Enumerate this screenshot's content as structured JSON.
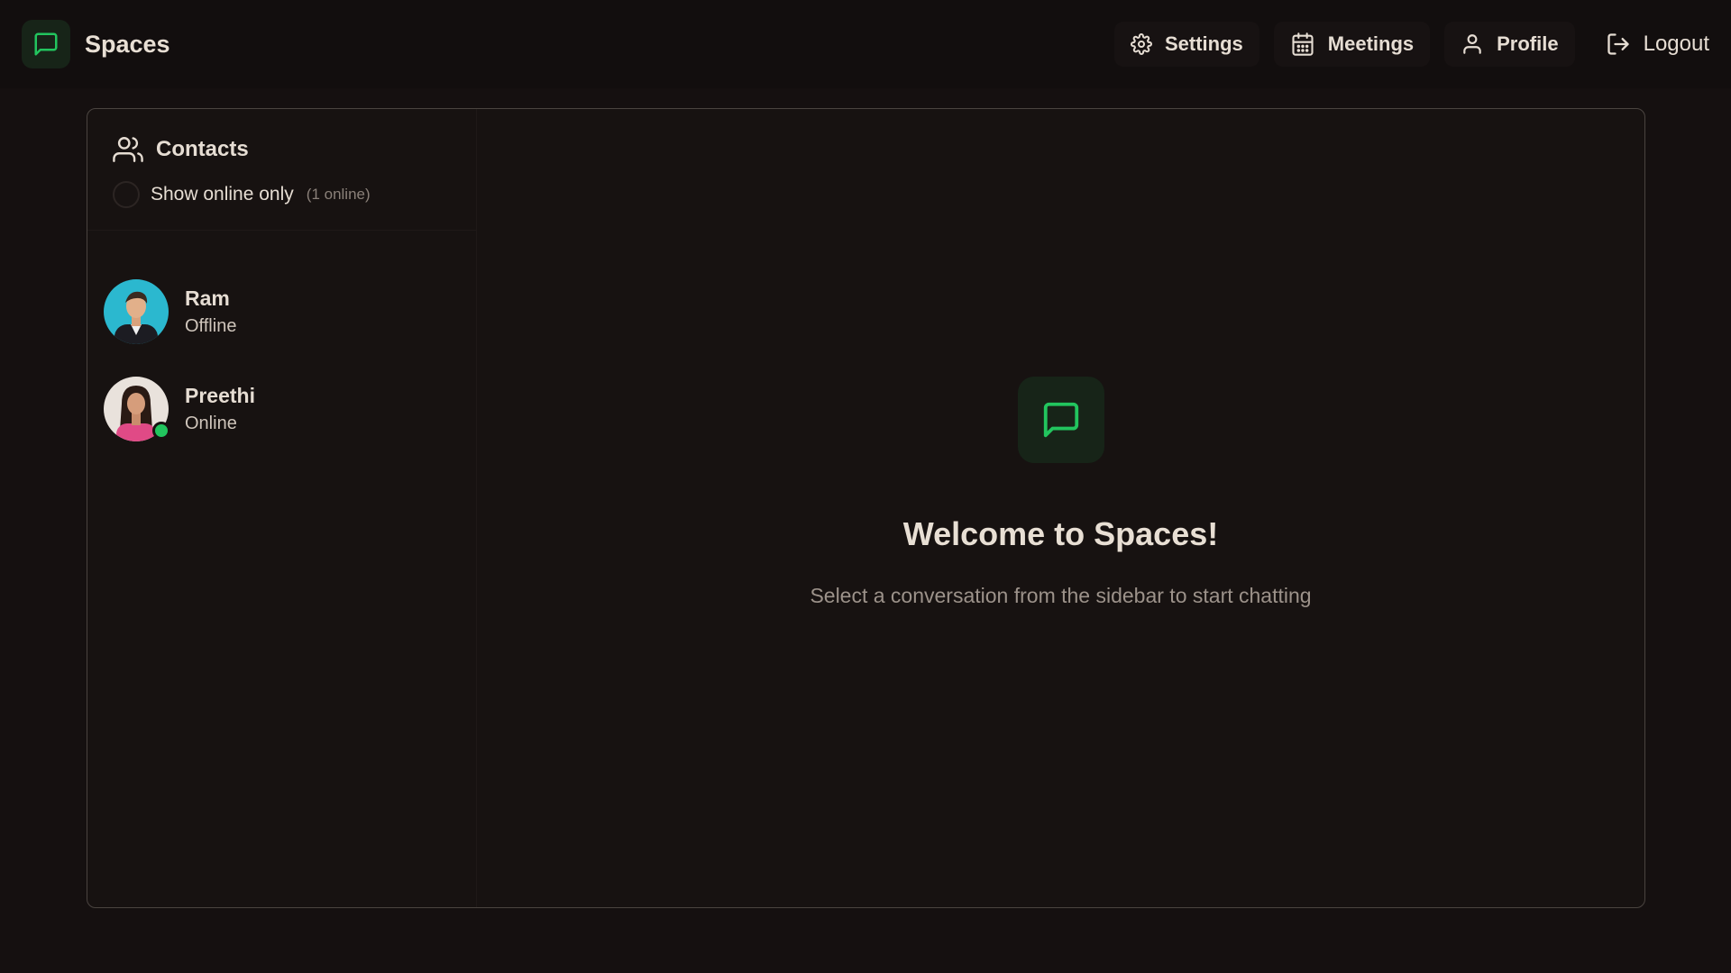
{
  "app": {
    "name": "Spaces",
    "accent_color": "#22c55e",
    "logo_icon": "message-square-icon"
  },
  "nav": {
    "settings": {
      "label": "Settings",
      "icon": "gear-icon"
    },
    "meetings": {
      "label": "Meetings",
      "icon": "calendar-icon"
    },
    "profile": {
      "label": "Profile",
      "icon": "user-icon"
    },
    "logout": {
      "label": "Logout",
      "icon": "logout-icon"
    }
  },
  "sidebar": {
    "title": "Contacts",
    "title_icon": "users-icon",
    "filter": {
      "label": "Show online only",
      "count": "(1 online)",
      "checked": false
    },
    "contacts": [
      {
        "name": "Ram",
        "status": "Offline",
        "online": false
      },
      {
        "name": "Preethi",
        "status": "Online",
        "online": true
      }
    ]
  },
  "welcome": {
    "icon": "message-square-icon",
    "title": "Welcome to Spaces!",
    "subtitle": "Select a conversation from the sidebar to start chatting"
  }
}
